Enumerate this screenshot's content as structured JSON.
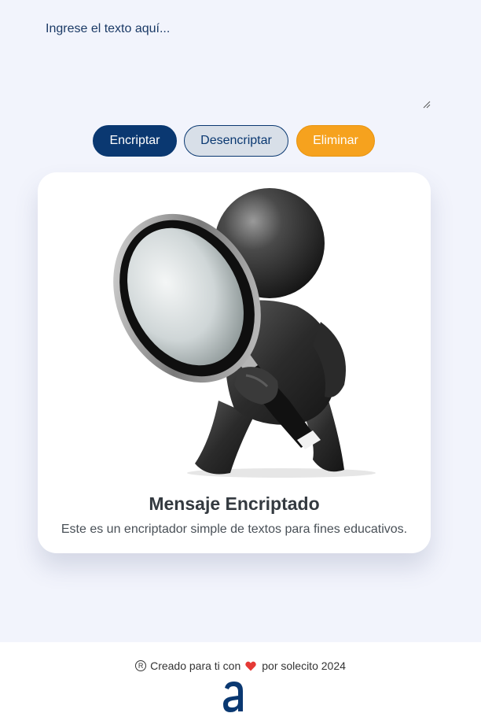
{
  "input": {
    "placeholder": "Ingrese el texto aquí...",
    "value": ""
  },
  "buttons": {
    "encrypt_label": "Encriptar",
    "decrypt_label": "Desencriptar",
    "clear_label": "Eliminar"
  },
  "result_card": {
    "image_icon": "magnifying-glass-figure",
    "title": "Mensaje Encriptado",
    "description": "Este es un encriptador simple de textos para fines educativos."
  },
  "footer": {
    "registered_symbol": "R",
    "text_before_heart": "Creado para ti con",
    "text_after_heart": "por solecito 2024",
    "heart_icon": "heart-icon",
    "logo_icon": "alura-logo-icon"
  },
  "colors": {
    "background": "#f2f4fc",
    "primary": "#0a3871",
    "secondary_bg": "#d8dfe8",
    "accent": "#f6a21e",
    "card": "#ffffff",
    "heart": "#e53935"
  }
}
